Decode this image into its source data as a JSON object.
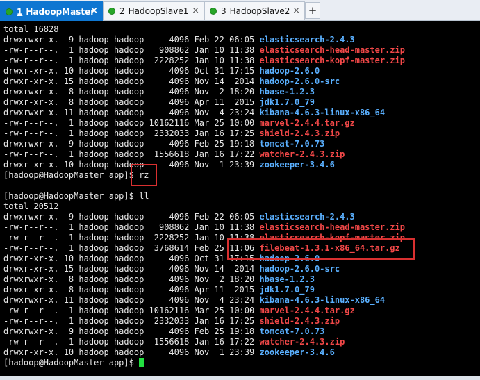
{
  "tabs": [
    {
      "num": "1",
      "label": "HadoopMaster",
      "active": true
    },
    {
      "num": "2",
      "label": "HadoopSlave1",
      "active": false
    },
    {
      "num": "3",
      "label": "HadoopSlave2",
      "active": false
    }
  ],
  "add_tab_label": "+",
  "close_glyph": "×",
  "terminal": {
    "lines": [
      {
        "pre": "total 16828",
        "name": "",
        "color": ""
      },
      {
        "pre": "drwxrwxr-x.  9 hadoop hadoop     4096 Feb 22 06:05 ",
        "name": "elasticsearch-2.4.3",
        "color": "blue"
      },
      {
        "pre": "-rw-r--r--.  1 hadoop hadoop   908862 Jan 10 11:38 ",
        "name": "elasticsearch-head-master.zip",
        "color": "red"
      },
      {
        "pre": "-rw-r--r--.  1 hadoop hadoop  2228252 Jan 10 11:38 ",
        "name": "elasticsearch-kopf-master.zip",
        "color": "red"
      },
      {
        "pre": "drwxr-xr-x. 10 hadoop hadoop     4096 Oct 31 17:15 ",
        "name": "hadoop-2.6.0",
        "color": "blue"
      },
      {
        "pre": "drwxr-xr-x. 15 hadoop hadoop     4096 Nov 14  2014 ",
        "name": "hadoop-2.6.0-src",
        "color": "blue"
      },
      {
        "pre": "drwxrwxr-x.  8 hadoop hadoop     4096 Nov  2 18:20 ",
        "name": "hbase-1.2.3",
        "color": "blue"
      },
      {
        "pre": "drwxr-xr-x.  8 hadoop hadoop     4096 Apr 11  2015 ",
        "name": "jdk1.7.0_79",
        "color": "blue"
      },
      {
        "pre": "drwxrwxr-x. 11 hadoop hadoop     4096 Nov  4 23:24 ",
        "name": "kibana-4.6.3-linux-x86_64",
        "color": "blue"
      },
      {
        "pre": "-rw-r--r--.  1 hadoop hadoop 10162116 Mar 25 10:00 ",
        "name": "marvel-2.4.4.tar.gz",
        "color": "red"
      },
      {
        "pre": "-rw-r--r--.  1 hadoop hadoop  2332033 Jan 16 17:25 ",
        "name": "shield-2.4.3.zip",
        "color": "red"
      },
      {
        "pre": "drwxrwxr-x.  9 hadoop hadoop     4096 Feb 25 19:18 ",
        "name": "tomcat-7.0.73",
        "color": "blue"
      },
      {
        "pre": "-rw-r--r--.  1 hadoop hadoop  1556618 Jan 16 17:22 ",
        "name": "watcher-2.4.3.zip",
        "color": "red"
      },
      {
        "pre": "drwxr-xr-x. 10 hadoop hadoop     4096 Nov  1 23:39 ",
        "name": "zookeeper-3.4.6",
        "color": "blue"
      },
      {
        "pre": "[hadoop@HadoopMaster app]$ rz",
        "name": "",
        "color": ""
      },
      {
        "pre": "",
        "name": "",
        "color": ""
      },
      {
        "pre": "[hadoop@HadoopMaster app]$ ll",
        "name": "",
        "color": ""
      },
      {
        "pre": "total 20512",
        "name": "",
        "color": ""
      },
      {
        "pre": "drwxrwxr-x.  9 hadoop hadoop     4096 Feb 22 06:05 ",
        "name": "elasticsearch-2.4.3",
        "color": "blue"
      },
      {
        "pre": "-rw-r--r--.  1 hadoop hadoop   908862 Jan 10 11:38 ",
        "name": "elasticsearch-head-master.zip",
        "color": "red"
      },
      {
        "pre": "-rw-r--r--.  1 hadoop hadoop  2228252 Jan 10 11:38 ",
        "name": "elasticsearch-kopf-master.zip",
        "color": "red"
      },
      {
        "pre": "-rw-r--r--.  1 hadoop hadoop  3768614 Feb 25 11:06 ",
        "name": "filebeat-1.3.1-x86_64.tar.gz",
        "color": "red"
      },
      {
        "pre": "drwxr-xr-x. 10 hadoop hadoop     4096 Oct 31 17:15 ",
        "name": "hadoop-2.6.0",
        "color": "blue"
      },
      {
        "pre": "drwxr-xr-x. 15 hadoop hadoop     4096 Nov 14  2014 ",
        "name": "hadoop-2.6.0-src",
        "color": "blue"
      },
      {
        "pre": "drwxrwxr-x.  8 hadoop hadoop     4096 Nov  2 18:20 ",
        "name": "hbase-1.2.3",
        "color": "blue"
      },
      {
        "pre": "drwxr-xr-x.  8 hadoop hadoop     4096 Apr 11  2015 ",
        "name": "jdk1.7.0_79",
        "color": "blue"
      },
      {
        "pre": "drwxrwxr-x. 11 hadoop hadoop     4096 Nov  4 23:24 ",
        "name": "kibana-4.6.3-linux-x86_64",
        "color": "blue"
      },
      {
        "pre": "-rw-r--r--.  1 hadoop hadoop 10162116 Mar 25 10:00 ",
        "name": "marvel-2.4.4.tar.gz",
        "color": "red"
      },
      {
        "pre": "-rw-r--r--.  1 hadoop hadoop  2332033 Jan 16 17:25 ",
        "name": "shield-2.4.3.zip",
        "color": "red"
      },
      {
        "pre": "drwxrwxr-x.  9 hadoop hadoop     4096 Feb 25 19:18 ",
        "name": "tomcat-7.0.73",
        "color": "blue"
      },
      {
        "pre": "-rw-r--r--.  1 hadoop hadoop  1556618 Jan 16 17:22 ",
        "name": "watcher-2.4.3.zip",
        "color": "red"
      },
      {
        "pre": "drwxr-xr-x. 10 hadoop hadoop     4096 Nov  1 23:39 ",
        "name": "zookeeper-3.4.6",
        "color": "blue"
      },
      {
        "pre": "[hadoop@HadoopMaster app]$ ",
        "name": "",
        "color": "",
        "cursor": true
      }
    ]
  },
  "colors": {
    "background": "#000000",
    "dir": "#5ab0ff",
    "archive": "#f24848",
    "text": "#e6e6e6",
    "cursor": "#22e040",
    "highlight": "#d93030",
    "active_tab": "#0e76d1"
  }
}
